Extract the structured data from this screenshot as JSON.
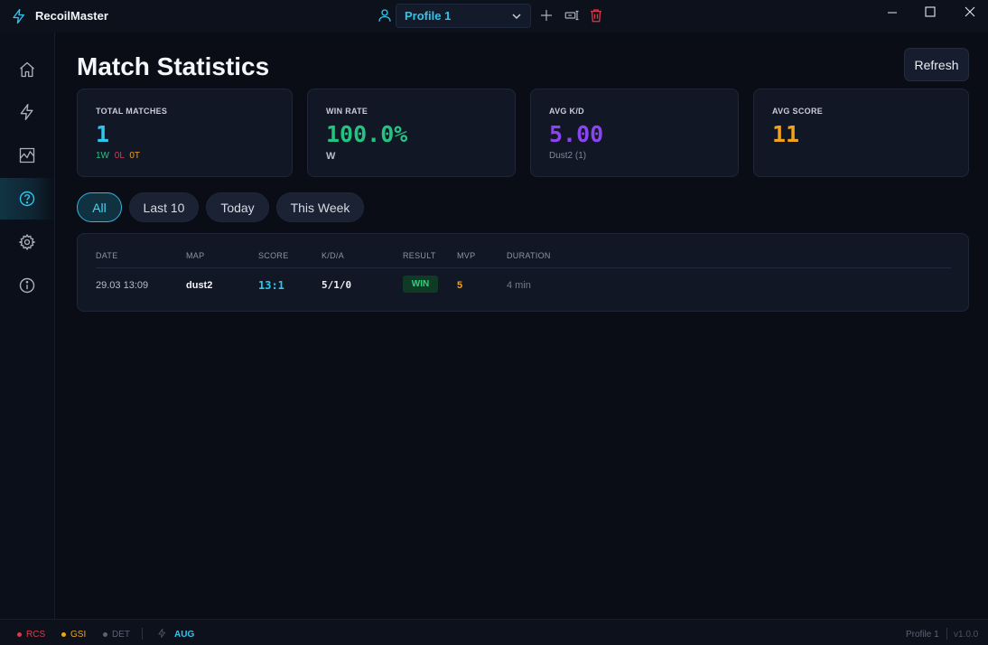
{
  "app": {
    "title": "RecoilMaster"
  },
  "profile": {
    "selected": "Profile 1"
  },
  "page": {
    "title": "Match Statistics",
    "refresh_label": "Refresh"
  },
  "stats": [
    {
      "label": "TOTAL MATCHES",
      "value": "1",
      "color": "#2fc6ec"
    },
    {
      "label": "WIN RATE",
      "value": "100.0%",
      "color": "#26c281",
      "sub": "W"
    },
    {
      "label": "AVG K/D",
      "value": "5.00",
      "color": "#8b45f0",
      "sub": "Dust2 (1)"
    },
    {
      "label": "AVG SCORE",
      "value": "11",
      "color": "#f0a21b"
    }
  ],
  "record": {
    "wins": "1W",
    "losses": "0L",
    "ties": "0T"
  },
  "filters": [
    {
      "label": "All",
      "active": true
    },
    {
      "label": "Last 10"
    },
    {
      "label": "Today"
    },
    {
      "label": "This Week"
    }
  ],
  "table": {
    "headers": [
      "DATE",
      "MAP",
      "SCORE",
      "K/D/A",
      "RESULT",
      "MVP",
      "DURATION"
    ],
    "rows": [
      {
        "date": "29.03 13:09",
        "map": "dust2",
        "score": "13:1",
        "kda": "5/1/0",
        "result": "WIN",
        "mvp": "5",
        "duration": "4 min"
      }
    ]
  },
  "status": {
    "rcs": "RCS",
    "gsi": "GSI",
    "det": "DET",
    "weapon": "AUG",
    "profile": "Profile 1",
    "version": "v1.0.0"
  },
  "colors": {
    "accent": "#2fc6ec",
    "win": "#33d17a",
    "danger": "#e0364a",
    "warning": "#f0a21b"
  }
}
